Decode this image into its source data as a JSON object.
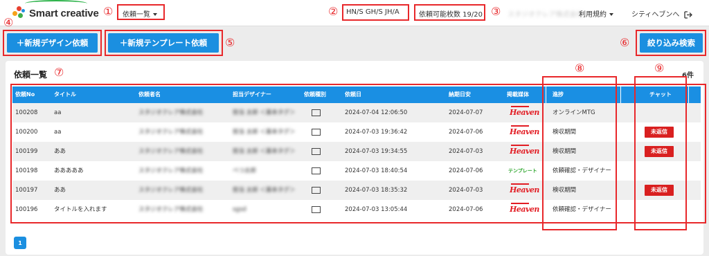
{
  "header": {
    "logo_text": "Smart creative",
    "menu_label": "依頼一覧",
    "plan_codes": "HN/S GH/S JH/A",
    "quota_label": "依頼可能枚数 19/20",
    "company_name": "スタジオクレア株式会社",
    "terms_label": "利用規約",
    "user_name": "シティヘブンへ",
    "logout_icon": "logout-icon"
  },
  "actions": {
    "new_design": "＋新規デザイン依頼",
    "new_template": "＋新規テンプレート依頼",
    "filter_search": "絞り込み検索"
  },
  "list": {
    "title": "依頼一覧",
    "count": "6件",
    "columns": [
      "依頼No",
      "タイトル",
      "依頼者名",
      "担当デザイナー",
      "依頼種別",
      "依頼日",
      "納期日安",
      "掲載媒体",
      "進捗",
      "チャット"
    ],
    "rows": [
      {
        "no": "100208",
        "title": "aa",
        "requester": "スタジオクレア株式会社",
        "designer": "担当 太郎 ＜基本タグ＞",
        "type": "mail-icon",
        "date": "2024-07-04 12:06:50",
        "due": "2024-07-07",
        "media": "Heaven",
        "status": "オンラインMTG",
        "chat": ""
      },
      {
        "no": "100200",
        "title": "aa",
        "requester": "スタジオクレア株式会社",
        "designer": "担当 太郎 ＜基本タグ＞",
        "type": "mail-icon",
        "date": "2024-07-03 19:36:42",
        "due": "2024-07-06",
        "media": "Heaven",
        "status": "検収期間",
        "chat": "未返信"
      },
      {
        "no": "100199",
        "title": "ああ",
        "requester": "スタジオクレア株式会社",
        "designer": "担当 太郎 ＜基本タグ＞",
        "type": "mail-icon",
        "date": "2024-07-03 19:34:55",
        "due": "2024-07-03",
        "media": "Heaven",
        "status": "検収期間",
        "chat": "未返信"
      },
      {
        "no": "100198",
        "title": "あああああ",
        "requester": "スタジオクレア株式会社",
        "designer": "べつ太郎",
        "type": "mail-icon",
        "date": "2024-07-03 18:40:54",
        "due": "2024-07-06",
        "media": "テンプレート",
        "status": "依頼確認・デザイナー",
        "chat": ""
      },
      {
        "no": "100197",
        "title": "ああ",
        "requester": "スタジオクレア株式会社",
        "designer": "担当 太郎 ＜基本タグ＞",
        "type": "mail-icon",
        "date": "2024-07-03 18:35:32",
        "due": "2024-07-03",
        "media": "Heaven",
        "status": "検収期間",
        "chat": "未返信"
      },
      {
        "no": "100196",
        "title": "タイトルを入れます",
        "requester": "スタジオクレア株式会社",
        "designer": "sgsd",
        "type": "mail-icon",
        "date": "2024-07-03 13:05:44",
        "due": "2024-07-06",
        "media": "Heaven",
        "status": "依頼確認・デザイナー",
        "chat": ""
      }
    ]
  },
  "pagination": {
    "current": "1"
  },
  "annotations": [
    "①",
    "②",
    "③",
    "④",
    "⑤",
    "⑥",
    "⑦",
    "⑧",
    "⑨"
  ],
  "colors": {
    "accent": "#1b8fe0",
    "annotation": "#e8272a",
    "badge": "#d92020"
  }
}
